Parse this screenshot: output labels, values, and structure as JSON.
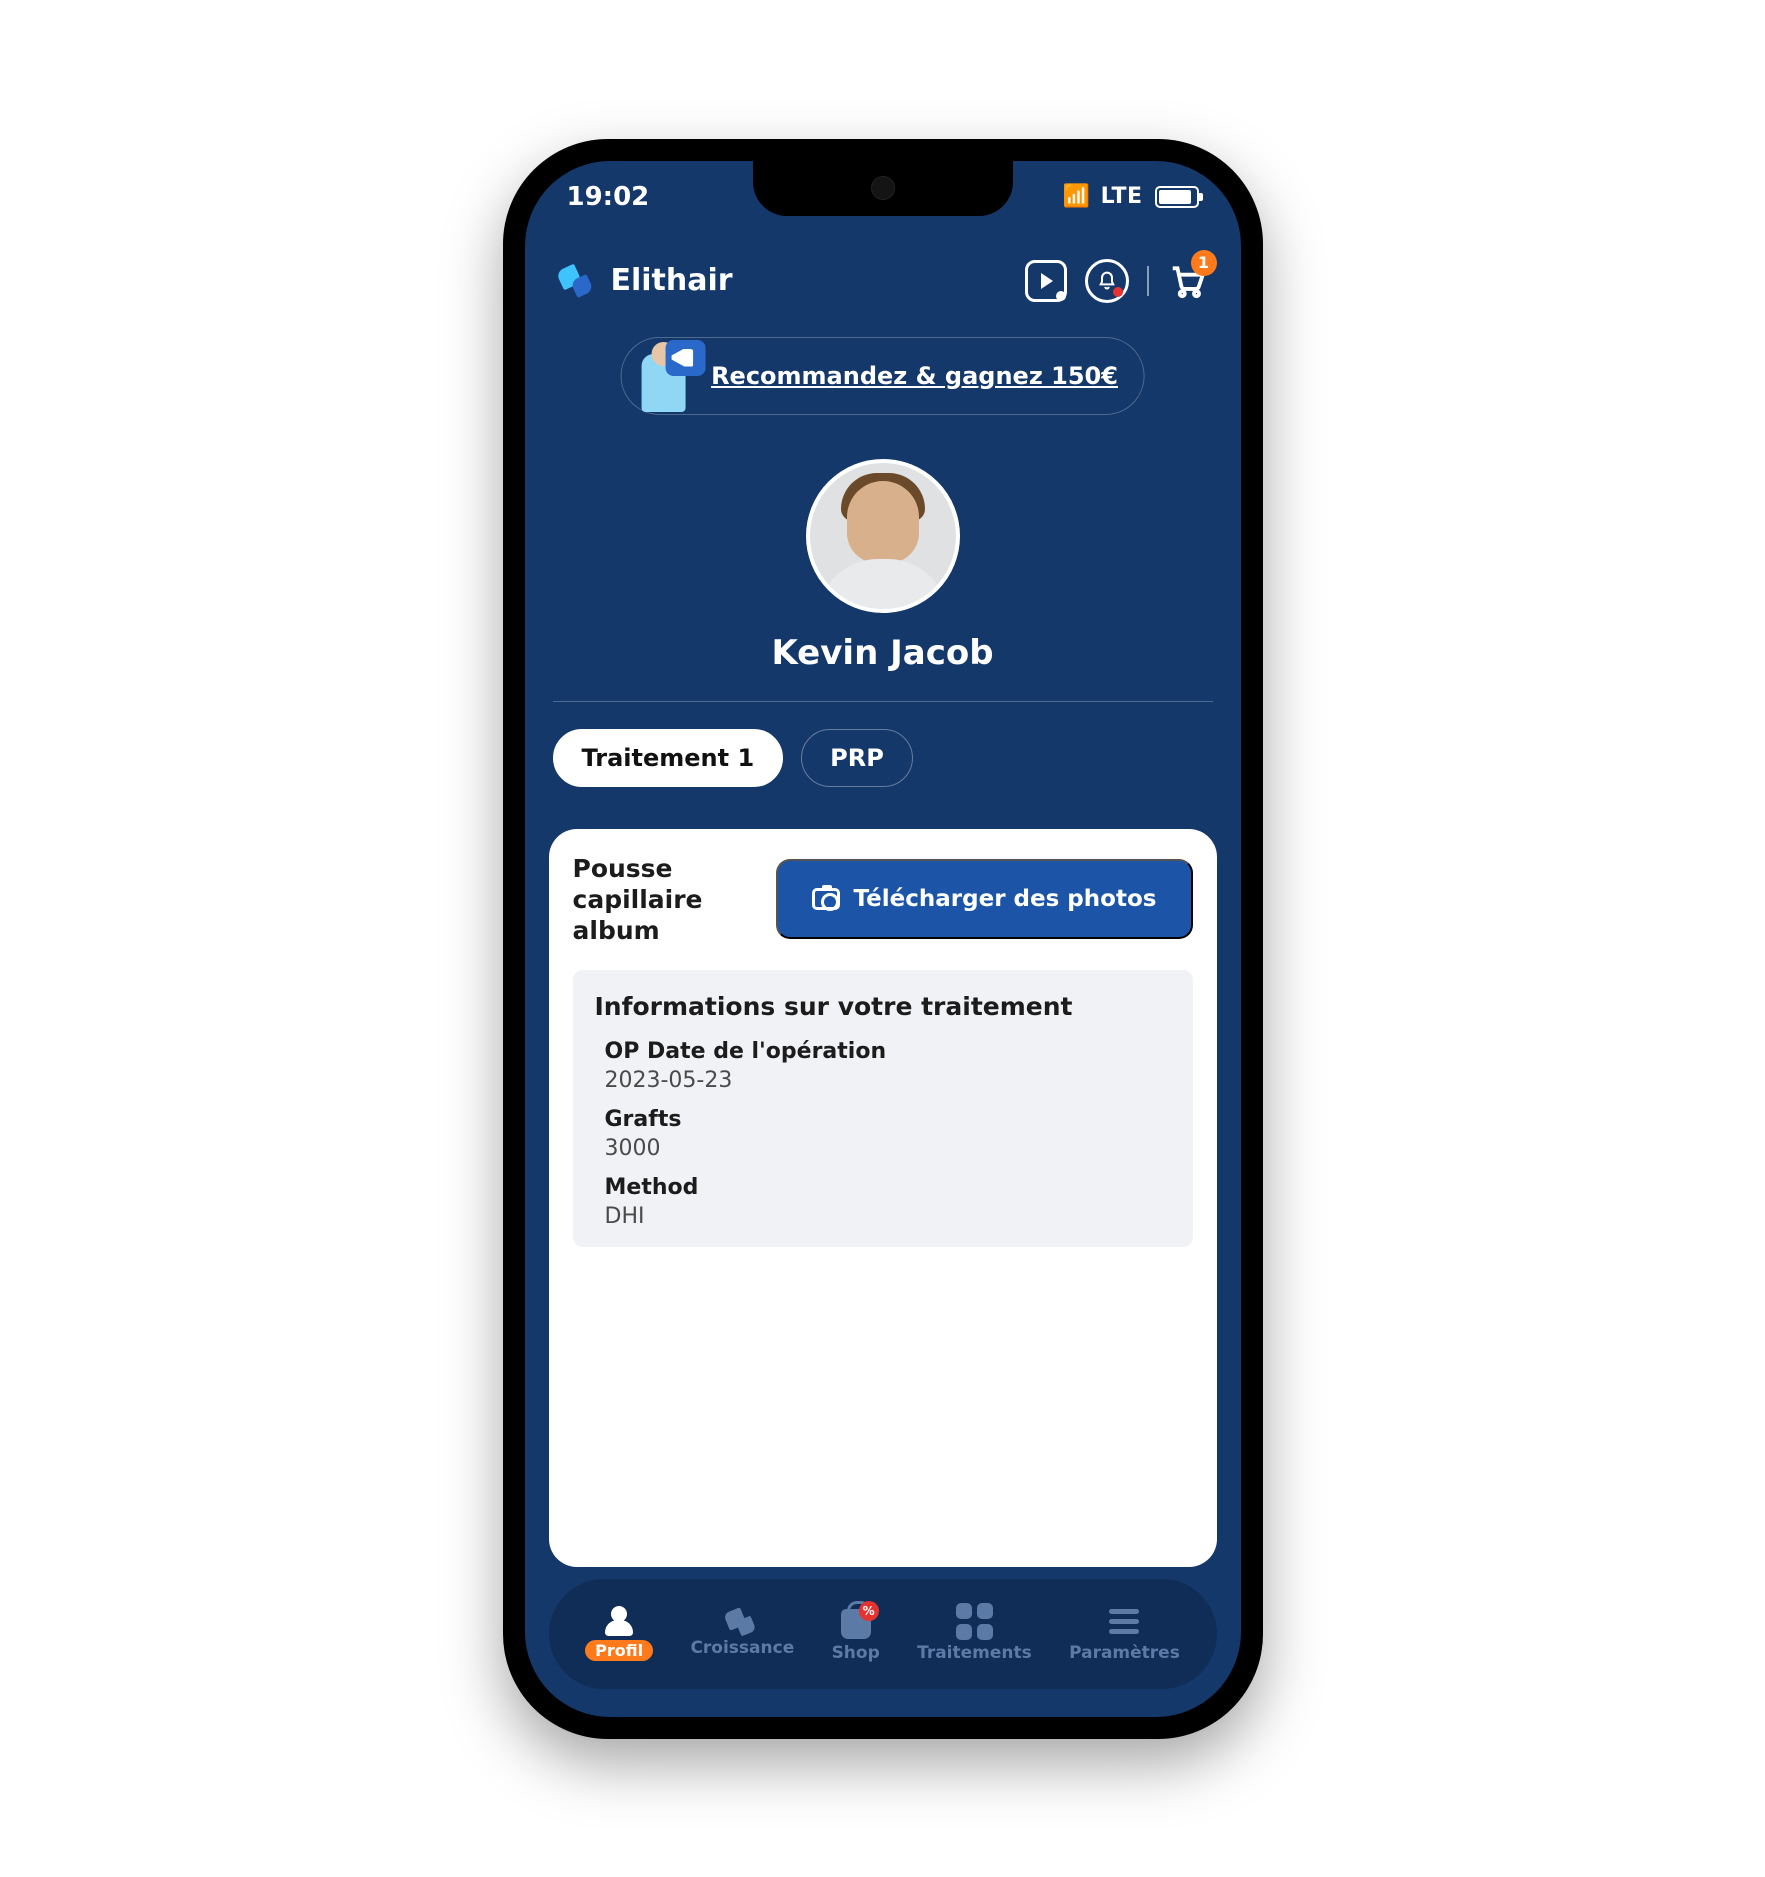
{
  "status": {
    "time": "19:02",
    "network": "LTE"
  },
  "brand": "Elithair",
  "cart": {
    "badge": "1"
  },
  "referral": {
    "text": "Recommandez & gagnez 150€"
  },
  "user": {
    "name": "Kevin Jacob"
  },
  "tabs": [
    {
      "label": "Traitement 1",
      "active": true
    },
    {
      "label": "PRP",
      "active": false
    }
  ],
  "album": {
    "title": "Pousse capillaire album",
    "upload_label": "Télécharger des photos"
  },
  "treatment_info": {
    "heading": "Informations sur votre traitement",
    "fields": [
      {
        "label": "OP Date de l'opération",
        "value": "2023-05-23"
      },
      {
        "label": "Grafts",
        "value": "3000"
      },
      {
        "label": "Method",
        "value": "DHI"
      }
    ]
  },
  "bottom_nav": [
    {
      "label": "Profil",
      "icon": "user",
      "active": true
    },
    {
      "label": "Croissance",
      "icon": "growth",
      "active": false
    },
    {
      "label": "Shop",
      "icon": "shop",
      "active": false,
      "badge": "%"
    },
    {
      "label": "Traitements",
      "icon": "grid",
      "active": false
    },
    {
      "label": "Paramètres",
      "icon": "menu",
      "active": false
    }
  ]
}
